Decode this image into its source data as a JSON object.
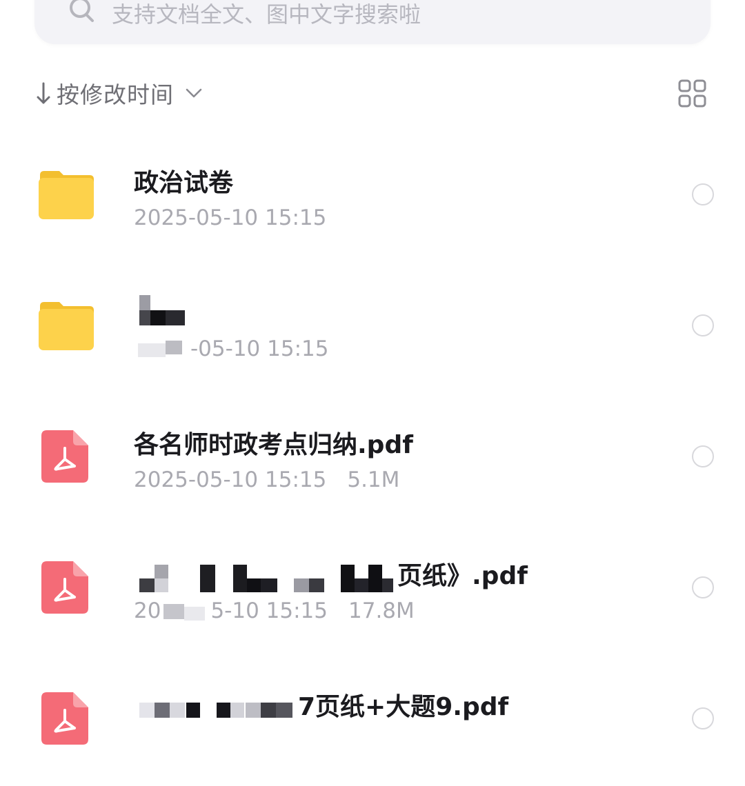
{
  "search": {
    "placeholder": "支持文档全文、图中文字搜索啦"
  },
  "sort": {
    "label": "按修改时间"
  },
  "files": [
    {
      "name": "政治试卷",
      "type": "folder",
      "date": "2025-05-10 15:15",
      "size": ""
    },
    {
      "name": "",
      "type": "folder",
      "date": "-05-10 15:15",
      "size": ""
    },
    {
      "name": "各名师时政考点归纳.pdf",
      "type": "pdf",
      "date": "2025-05-10 15:15",
      "size": "5.1M"
    },
    {
      "name": "页纸》.pdf",
      "type": "pdf",
      "date": "5-10 15:15",
      "size": "17.8M"
    },
    {
      "name": "7页纸+大题9.pdf",
      "type": "pdf",
      "date": "",
      "size": ""
    }
  ],
  "colors": {
    "folder": "#fdd24b",
    "pdf": "#f46b77",
    "meta_text": "#a9a9b0",
    "search_bg": "#f3f3f7"
  }
}
